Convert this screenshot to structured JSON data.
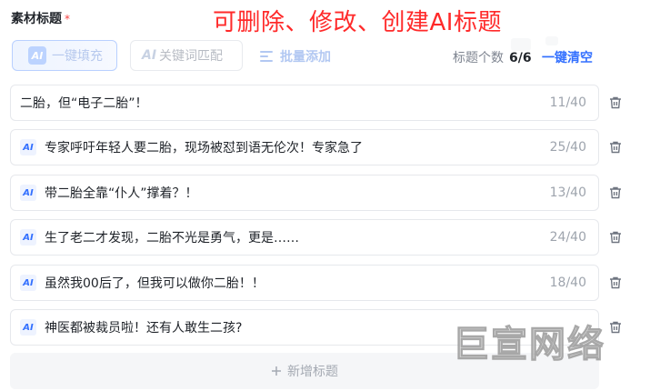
{
  "section": {
    "title": "素材标题",
    "required_mark": "*",
    "annotation": "可删除、修改、创建AI标题"
  },
  "toolbar": {
    "ai_chip": "AI",
    "oneclick_label": "一键填充",
    "ai_mark": "AI",
    "keyword_label": "关键词匹配",
    "batch_label": "批量添加",
    "count_label": "标题个数",
    "count_value": "6/6",
    "clear_label": "一键清空"
  },
  "titles": [
    {
      "text": "二胎，但“电子二胎”！",
      "ai": false,
      "count": "11/40"
    },
    {
      "text": "专家呼吁年轻人要二胎，现场被怼到语无伦次！专家急了",
      "ai": true,
      "badge": "AI",
      "count": "25/40"
    },
    {
      "text": "带二胎全靠“仆人”撑着？！",
      "ai": true,
      "badge": "AI",
      "count": "13/40"
    },
    {
      "text": "生了老二才发现，二胎不光是勇气，更是……",
      "ai": true,
      "badge": "AI",
      "count": "24/40"
    },
    {
      "text": "虽然我00后了，但我可以做你二胎！！",
      "ai": true,
      "badge": "AI",
      "count": "18/40"
    },
    {
      "text": "神医都被裁员啦！还有人敢生二孩?",
      "ai": true,
      "badge": "AI",
      "count": ""
    }
  ],
  "add_row": {
    "label": "新增标题"
  },
  "watermark": "巨宣网络",
  "colors": {
    "accent": "#3370ff",
    "annotation": "#ff2a2a",
    "required": "#f53f3f"
  }
}
